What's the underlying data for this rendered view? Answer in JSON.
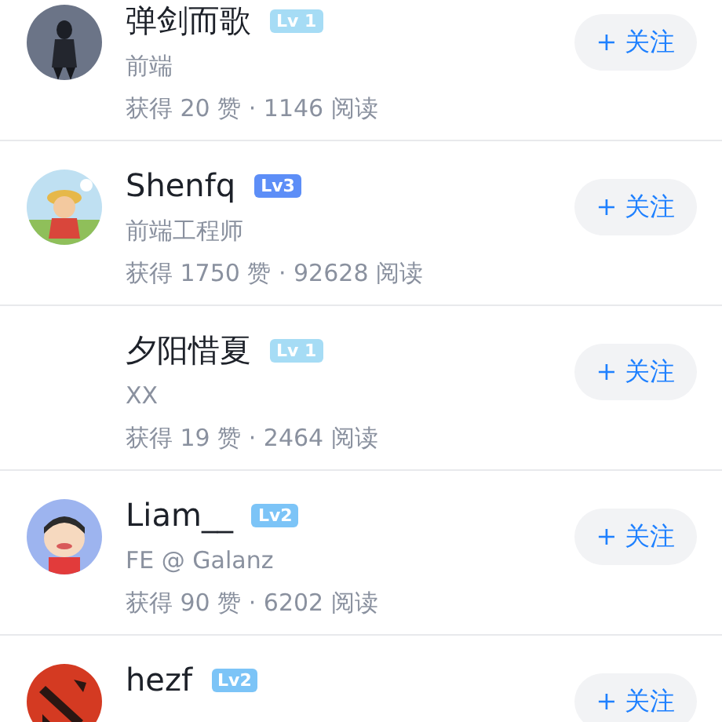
{
  "users": [
    {
      "name": "弹剑而歌",
      "level": "Lv 1",
      "color": "#a6dcf5",
      "avatar": true,
      "title": "前端",
      "stats": "获得 20 赞 · 1146 阅读",
      "follow": "+ 关注"
    },
    {
      "name": "Shenfq",
      "level": "Lv3",
      "color": "#5d8ef7",
      "avatar": true,
      "title": "前端工程师",
      "stats": "获得 1750 赞 · 92628 阅读",
      "follow": "+ 关注"
    },
    {
      "name": "夕阳惜夏",
      "level": "Lv 1",
      "color": "#a6dcf5",
      "avatar": false,
      "title": "XX",
      "stats": "获得 19 赞 · 2464 阅读",
      "follow": "+ 关注"
    },
    {
      "name": "Liam__",
      "level": "Lv2",
      "color": "#7cc4f7",
      "avatar": true,
      "title": "FE @ Galanz",
      "stats": "获得 90 赞 · 6202 阅读",
      "follow": "+ 关注"
    },
    {
      "name": "hezf",
      "level": "Lv2",
      "color": "#7cc4f7",
      "avatar": true,
      "follow": "+ 关注"
    }
  ]
}
